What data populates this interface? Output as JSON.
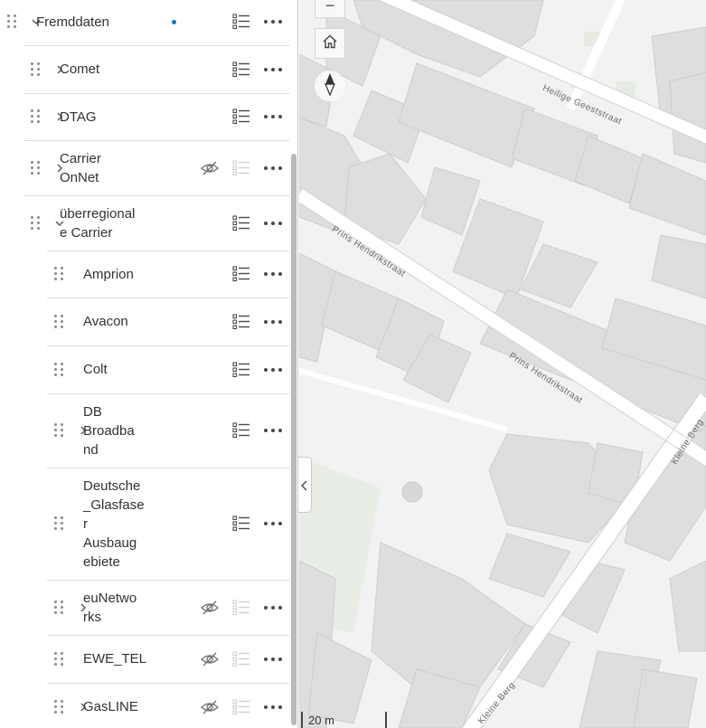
{
  "layers": [
    {
      "label": "Fremddaten",
      "expandable": true,
      "expanded": true,
      "level": 0,
      "visible": true,
      "highlight_dot": true
    },
    {
      "label": "Comet",
      "expandable": true,
      "expanded": false,
      "level": 1,
      "visible": true
    },
    {
      "label": "DTAG",
      "expandable": true,
      "expanded": false,
      "level": 1,
      "visible": true
    },
    {
      "label_lines": [
        "Carrier",
        "OnNet"
      ],
      "expandable": true,
      "expanded": false,
      "level": 1,
      "visible": false
    },
    {
      "label_lines": [
        "überregional",
        "e Carrier"
      ],
      "expandable": true,
      "expanded": true,
      "level": 1,
      "visible": true
    },
    {
      "label": "Amprion",
      "expandable": false,
      "level": 2,
      "visible": true
    },
    {
      "label": "Avacon",
      "expandable": false,
      "level": 2,
      "visible": true
    },
    {
      "label": "Colt",
      "expandable": false,
      "level": 2,
      "visible": true
    },
    {
      "label_lines": [
        "DB",
        "Broadba",
        "nd"
      ],
      "expandable": true,
      "expanded": false,
      "level": 2,
      "visible": true
    },
    {
      "label_lines": [
        "Deutsche",
        "_Glasfase",
        "r",
        "Ausbaug",
        "ebiete"
      ],
      "expandable": false,
      "level": 2,
      "visible": true
    },
    {
      "label_lines": [
        "euNetwo",
        "rks"
      ],
      "expandable": true,
      "expanded": false,
      "level": 2,
      "visible": false
    },
    {
      "label": "EWE_TEL",
      "expandable": false,
      "level": 2,
      "visible": false
    },
    {
      "label": "GasLINE",
      "expandable": true,
      "expanded": false,
      "level": 2,
      "visible": false
    }
  ],
  "map": {
    "streets": [
      "Heilige Geeststraat",
      "Prins Hendrikstraat",
      "Prins Hendrikstraat",
      "Kleine Berg",
      "Kleine Berg"
    ],
    "scale_label": "20 m",
    "zoom_out_label": "−"
  },
  "colors": {
    "accent": "#007ac2",
    "map_background": "#f2f2f2",
    "buildings": "#dedede",
    "roads": "#ffffff"
  },
  "icons": [
    "drag-handle-icon",
    "chevron-right-icon",
    "chevron-down-icon",
    "legend-list-icon",
    "visibility-off-icon",
    "more-options-icon",
    "home-icon",
    "compass-icon",
    "collapse-panel-icon"
  ]
}
